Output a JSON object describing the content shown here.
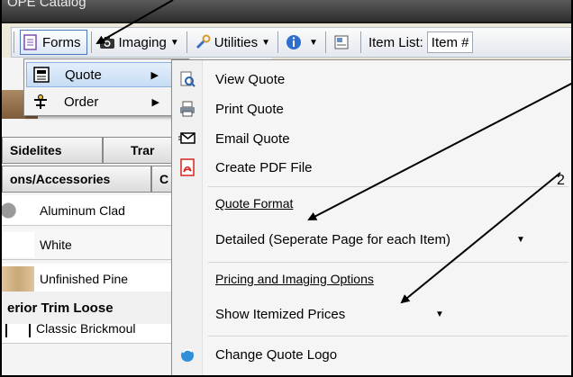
{
  "window": {
    "title": "OPE Catalog"
  },
  "toolbar": {
    "forms_label": "Forms",
    "imaging_label": "Imaging",
    "utilities_label": "Utilities",
    "item_list_label": "Item List:",
    "item_list_value": "Item #",
    "icons": [
      "forms-icon",
      "camera-icon",
      "wrench-icon",
      "info-icon",
      "settings-icon"
    ]
  },
  "background": {
    "tabs_row1": [
      "Sidelites",
      "Trar"
    ],
    "tabs_row2": [
      "ons/Accessories",
      "C"
    ],
    "options": [
      {
        "label": "Aluminum Clad",
        "swatch": "#c8c8c8"
      },
      {
        "label": "White",
        "swatch": "#ffffff"
      },
      {
        "label": "Unfinished Pine",
        "swatch": "#d8b98e"
      },
      {
        "label": "Classic Brickmoul",
        "swatch": "none"
      }
    ],
    "trim_label": "erior Trim Loose"
  },
  "forms_menu": {
    "items": [
      {
        "label": "Quote",
        "icon": "quote-form-icon",
        "highlighted": true
      },
      {
        "label": "Order",
        "icon": "order-form-icon",
        "highlighted": false
      }
    ]
  },
  "quote_menu": {
    "view_quote": "View Quote",
    "print_quote": "Print Quote",
    "email_quote": "Email Quote",
    "create_pdf": "Create PDF File",
    "format_heading": "Quote Format",
    "format_value": "Detailed (Seperate Page for each Item)",
    "pricing_heading": "Pricing and Imaging Options",
    "pricing_value": "Show Itemized Prices",
    "change_logo": "Change Quote Logo"
  },
  "annotations": {
    "number": "2"
  },
  "colors": {
    "menu_highlight": "#c6dcf4",
    "pdf_red": "#d7261e",
    "arrow": "#000000"
  }
}
